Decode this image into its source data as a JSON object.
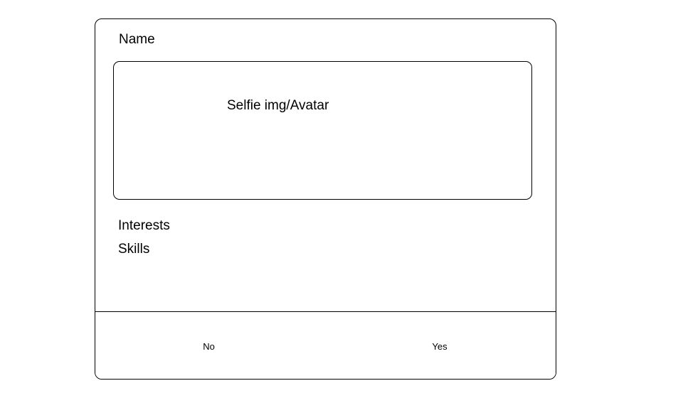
{
  "profile": {
    "name_label": "Name",
    "avatar_placeholder": "Selfie img/Avatar",
    "interests_label": "Interests",
    "skills_label": "Skills"
  },
  "actions": {
    "no_label": "No",
    "yes_label": "Yes"
  }
}
